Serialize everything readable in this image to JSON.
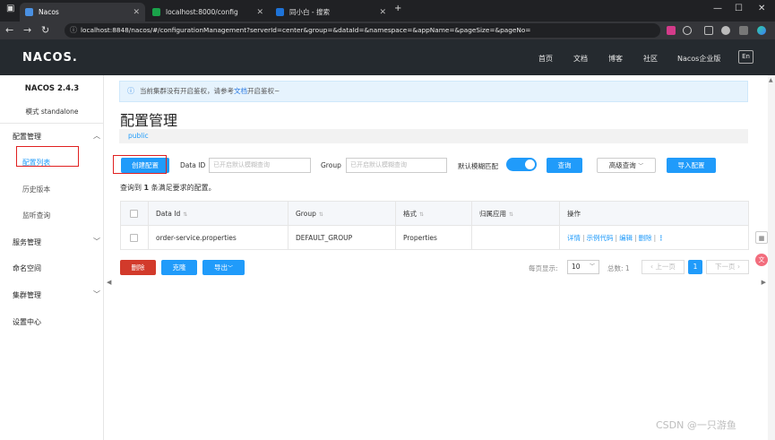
{
  "browser": {
    "tabs": [
      {
        "title": "Nacos",
        "active": true,
        "favicon_color": "#4a90e2"
      },
      {
        "title": "localhost:8000/config",
        "active": false,
        "favicon_color": "#1aa34a"
      },
      {
        "title": "同小白 - 搜索",
        "active": false,
        "favicon_color": "#1e73d8"
      }
    ],
    "url": "localhost:8848/nacos/#/configurationManagement?serverId=center&group=&dataId=&namespace=&appName=&pageSize=&pageNo="
  },
  "header": {
    "logo": "NACOS.",
    "links": [
      "首页",
      "文档",
      "博客",
      "社区",
      "Nacos企业版"
    ],
    "lang": "En"
  },
  "sidebar": {
    "version": "NACOS 2.4.3",
    "mode": "模式 standalone",
    "groups": [
      {
        "label": "配置管理",
        "expanded": true,
        "items": [
          "配置列表",
          "历史版本",
          "监听查询"
        ]
      },
      {
        "label": "服务管理",
        "expanded": false
      },
      {
        "label": "命名空间"
      },
      {
        "label": "集群管理",
        "expanded": false
      },
      {
        "label": "设置中心"
      }
    ]
  },
  "main": {
    "notice": "当前集群没有开启鉴权，请参考",
    "notice_link": "文档",
    "notice_tail": "开启鉴权~",
    "title": "配置管理",
    "namespace": "public",
    "toolbar": {
      "create": "创建配置",
      "dataid_label": "Data ID",
      "dataid_placeholder": "已开启默认模糊查询",
      "group_label": "Group",
      "group_placeholder": "已开启默认模糊查询",
      "fuzzy_label": "默认模糊匹配",
      "fuzzy_on": true,
      "search": "查询",
      "advanced": "高级查询",
      "import": "导入配置"
    },
    "result_prefix": "查询到",
    "result_count": "1",
    "result_suffix": "条满足要求的配置。",
    "table": {
      "headers": [
        "Data Id",
        "Group",
        "格式",
        "归属应用",
        "操作"
      ],
      "rows": [
        {
          "data_id": "order-service.properties",
          "group": "DEFAULT_GROUP",
          "format": "Properties",
          "app": "",
          "ops": [
            "详情",
            "示例代码",
            "编辑",
            "删除"
          ]
        }
      ]
    },
    "bottom": {
      "delete": "删除",
      "clone": "克隆",
      "export": "导出"
    },
    "pagination": {
      "page_size_label": "每页显示:",
      "page_size": "10",
      "total_label": "总数: 1",
      "prev": "上一页",
      "current": "1",
      "next": "下一页"
    }
  },
  "watermark": "CSDN @一只游鱼"
}
